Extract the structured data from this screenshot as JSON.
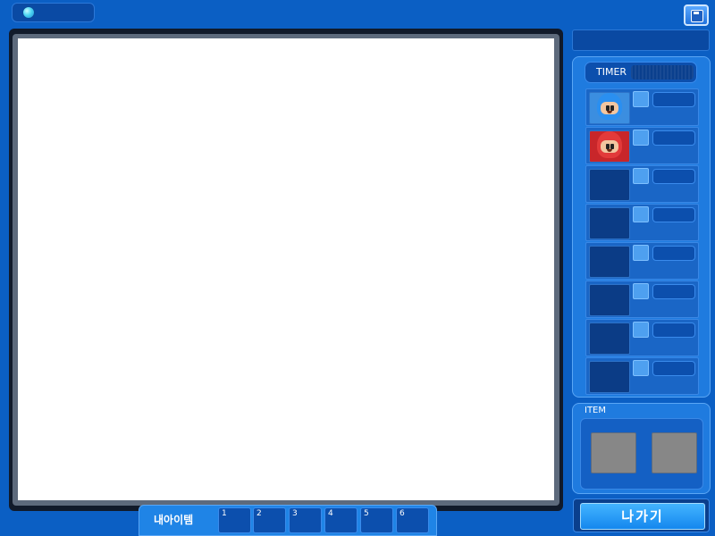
{
  "header": {
    "room_info": "",
    "icon": "globe-icon",
    "save_icon": "floppy-disk-icon"
  },
  "room_title": "",
  "players": {
    "timer_label": "TIMER",
    "slots": [
      {
        "character": "blue-bomber",
        "name": "",
        "ready": false
      },
      {
        "character": "red-bomber",
        "name": "",
        "ready": false
      },
      {
        "character": "",
        "name": "",
        "ready": false
      },
      {
        "character": "",
        "name": "",
        "ready": false
      },
      {
        "character": "",
        "name": "",
        "ready": false
      },
      {
        "character": "",
        "name": "",
        "ready": false
      },
      {
        "character": "",
        "name": "",
        "ready": false
      },
      {
        "character": "",
        "name": "",
        "ready": false
      }
    ]
  },
  "item_panel": {
    "label": "ITEM",
    "slots": [
      "",
      ""
    ]
  },
  "exit_button": "나가기",
  "bottom": {
    "my_items_label": "내아이템",
    "quick_slots": [
      "1",
      "2",
      "3",
      "4",
      "5",
      "6"
    ]
  },
  "colors": {
    "background": "#0b5fc4",
    "panel": "#1f7bdf",
    "slot_dark": "#0c4fad",
    "board": "#ffffff",
    "exit_button": "#1487ee"
  }
}
